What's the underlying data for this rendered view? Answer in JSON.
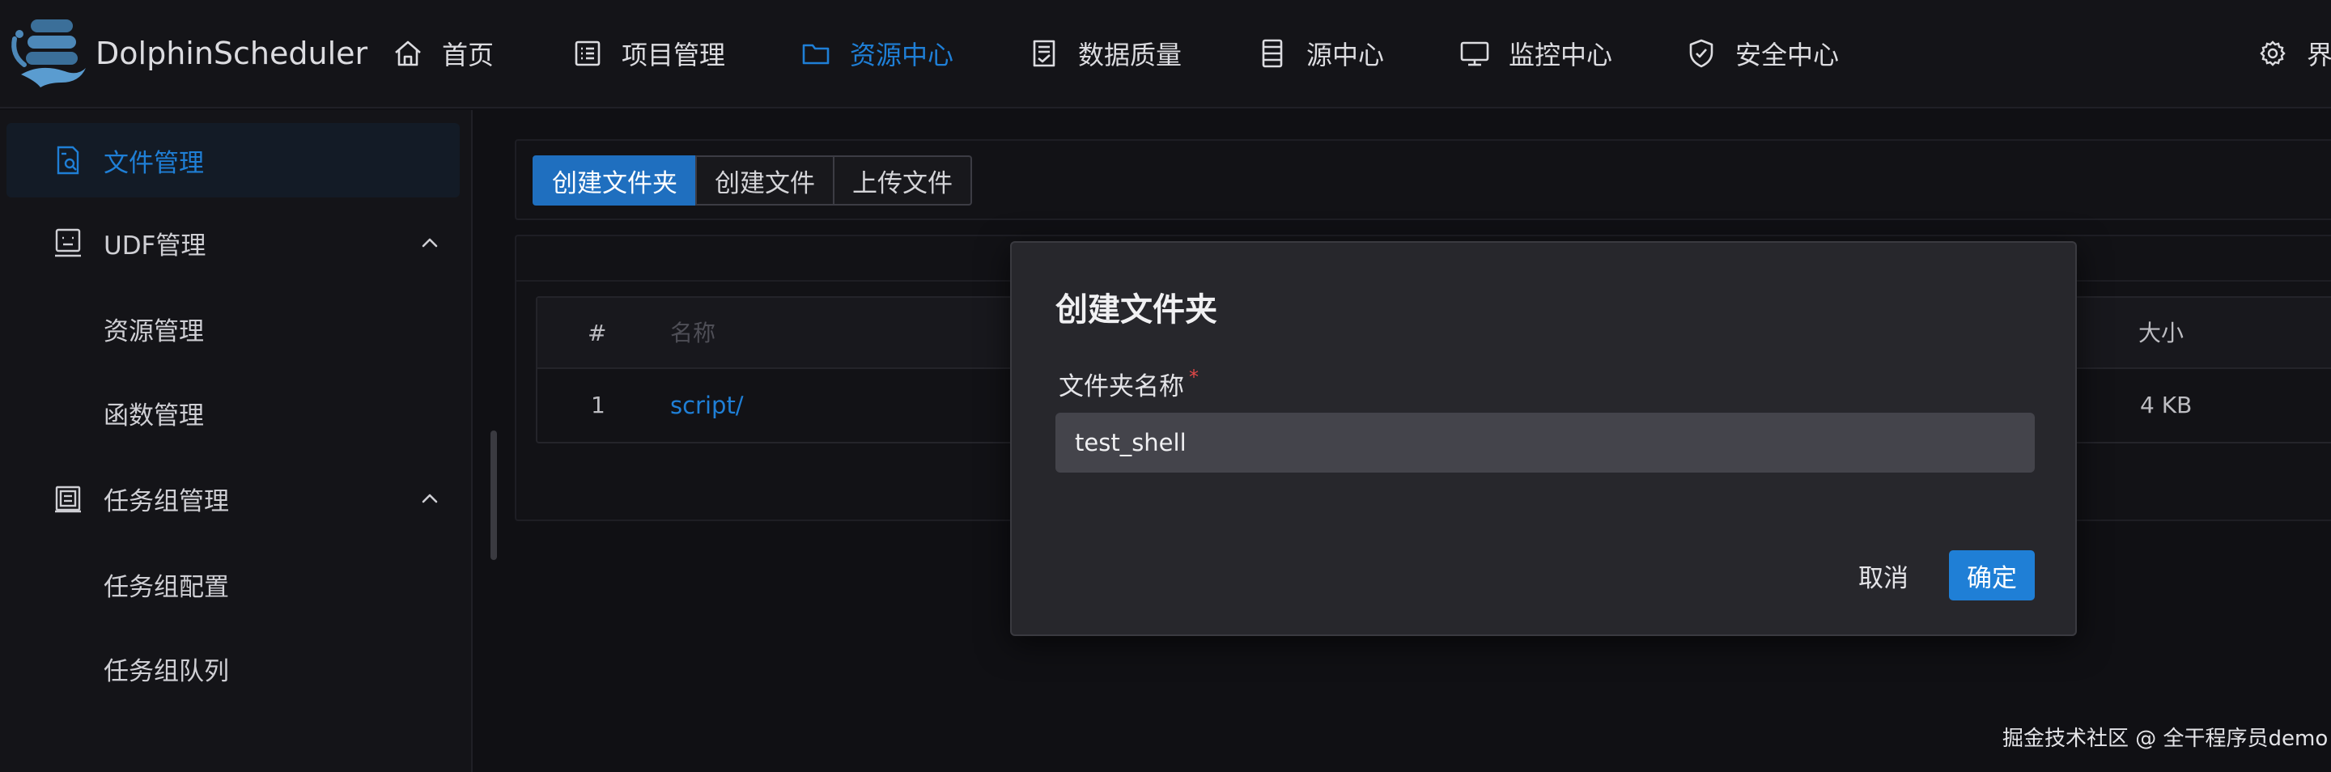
{
  "header": {
    "brand": "DolphinScheduler",
    "nav": [
      {
        "label": "首页",
        "icon": "home-icon"
      },
      {
        "label": "项目管理",
        "icon": "project-icon"
      },
      {
        "label": "资源中心",
        "icon": "folder-icon",
        "active": true
      },
      {
        "label": "数据质量",
        "icon": "data-quality-icon"
      },
      {
        "label": "源中心",
        "icon": "datasource-icon"
      },
      {
        "label": "监控中心",
        "icon": "monitor-icon"
      },
      {
        "label": "安全中心",
        "icon": "shield-icon"
      }
    ],
    "settings_label": "界面"
  },
  "sidebar": {
    "items": [
      {
        "label": "文件管理",
        "icon": "file-manage-icon",
        "active": true
      },
      {
        "label": "UDF管理",
        "icon": "udf-icon",
        "expanded": true
      },
      {
        "label": "资源管理"
      },
      {
        "label": "函数管理"
      },
      {
        "label": "任务组管理",
        "icon": "task-group-icon",
        "expanded": true
      },
      {
        "label": "任务组配置"
      },
      {
        "label": "任务组队列"
      }
    ]
  },
  "toolbar": {
    "create_folder": "创建文件夹",
    "create_file": "创建文件",
    "upload_file": "上传文件"
  },
  "table": {
    "columns": {
      "index": "#",
      "name": "名称",
      "size": "大小"
    },
    "rows": [
      {
        "index": "1",
        "name": "script/",
        "size": "4 KB"
      }
    ]
  },
  "modal": {
    "title": "创建文件夹",
    "field_label": "文件夹名称",
    "required_mark": "*",
    "field_value": "test_shell",
    "cancel": "取消",
    "confirm": "确定"
  },
  "watermark": "掘金技术社区 @ 全干程序员demo",
  "colors": {
    "accent": "#1f7fd6",
    "background": "#101014",
    "modal_bg": "#27272c",
    "required": "#e04848"
  }
}
